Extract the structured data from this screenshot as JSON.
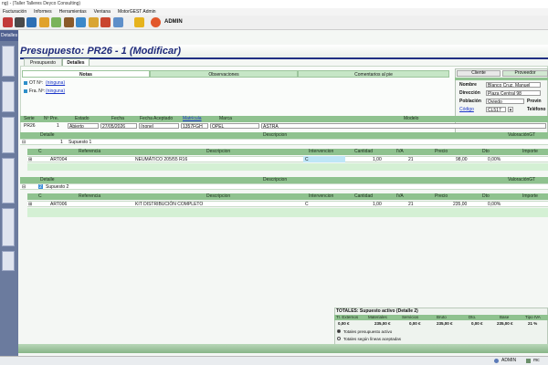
{
  "window": {
    "title": "ng) - (Taller Talleres Deyco Consulting)"
  },
  "menu": [
    "Facturación",
    "Informes",
    "Herramientas",
    "Ventana",
    "MotorGEST Admin"
  ],
  "toolbar": {
    "user": "ADMIN"
  },
  "left_panel": {
    "header": "Detalles"
  },
  "page": {
    "title": "Presupuesto: PR26 - 1 (Modificar)"
  },
  "tabs": [
    {
      "label": "Presupuesto",
      "active": false
    },
    {
      "label": "Detalles",
      "active": true
    }
  ],
  "subtabs": [
    {
      "label": "Notas",
      "active": true
    },
    {
      "label": "Observaciones",
      "active": false
    },
    {
      "label": "Comentarios al pie",
      "active": false
    }
  ],
  "notes": {
    "ot_label": "OT Nº:",
    "ot_link": "(ninguna)",
    "fra_label": "Fra. Nº:",
    "fra_link": "(ninguna)"
  },
  "customer": {
    "tabs": [
      "Cliente",
      "Proveedor"
    ],
    "nombre_label": "Nombre",
    "nombre": "Blanco Cruz, Manuel",
    "direccion_label": "Dirección",
    "direccion": "Plaza Central 98",
    "poblacion_label": "Población",
    "poblacion": "Oviedo",
    "provincia_label": "Provin",
    "codigo_label": "Código",
    "codigo": "CL517",
    "telefono_label": "Teléfono"
  },
  "header_fields": {
    "serie_label": "Serie",
    "serie": "PR26",
    "npre_label": "Nº Pre.",
    "npre": "1",
    "estado_label": "Estado",
    "estado": "Abierto",
    "fecha_label": "Fecha",
    "fecha": "27/05/2026",
    "fecha_aceptado_label": "Fecha Aceptado",
    "fecha_aceptado": "(none)",
    "matricula_label": "Matrícula",
    "matricula": "1357FGH",
    "marca_label": "Marca",
    "marca": "OPEL",
    "modelo_label": "Modelo",
    "modelo": "ASTRA"
  },
  "group_columns": {
    "detalle": "Detalle",
    "descripcion": "Descripcion",
    "valoracion": "ValoraciónGT"
  },
  "item_columns": [
    "C",
    "Referencia",
    "Descripcion",
    "Intervencion",
    "Cantidad",
    "IVA",
    "Precio",
    "Dto",
    "Importe"
  ],
  "supuestos": [
    {
      "num": "1",
      "name": "Supuesto 1",
      "items": [
        {
          "referencia": "ART004",
          "descripcion": "NEUMÁTICO 205/55 R16",
          "intervencion": "C",
          "cantidad": "1,00",
          "iva": "21",
          "precio": "98,00",
          "dto": "0,00%",
          "importe": ""
        }
      ]
    },
    {
      "num": "2",
      "name": "Supuesto 2",
      "items": [
        {
          "referencia": "ART006",
          "descripcion": "KIT DISTRIBUCIÓN COMPLETO",
          "intervencion": "C",
          "cantidad": "1,00",
          "iva": "21",
          "precio": "235,00",
          "dto": "0,00%",
          "importe": ""
        }
      ]
    }
  ],
  "totals": {
    "title": "TOTALES: Supuesto activo (Detalle 2)",
    "headers": [
      "Tr. Externos",
      "Materiales",
      "Servicios",
      "Bruto",
      "Dto.",
      "Base",
      "Tipo IVA"
    ],
    "values": [
      "0,00 €",
      "235,00 €",
      "0,00 €",
      "235,00 €",
      "0,00 €",
      "235,00 €",
      "21 %"
    ],
    "radio1": "Totales presupuesto activo",
    "radio2": "Totales según líneas aceptadas"
  },
  "status": {
    "user": "ADMIN",
    "host": "mc"
  },
  "colors": {
    "accent": "#1e2a7a",
    "green_header": "#8fc28f",
    "light_green": "#d4f0d4",
    "left_panel": "#6b7b9e"
  }
}
